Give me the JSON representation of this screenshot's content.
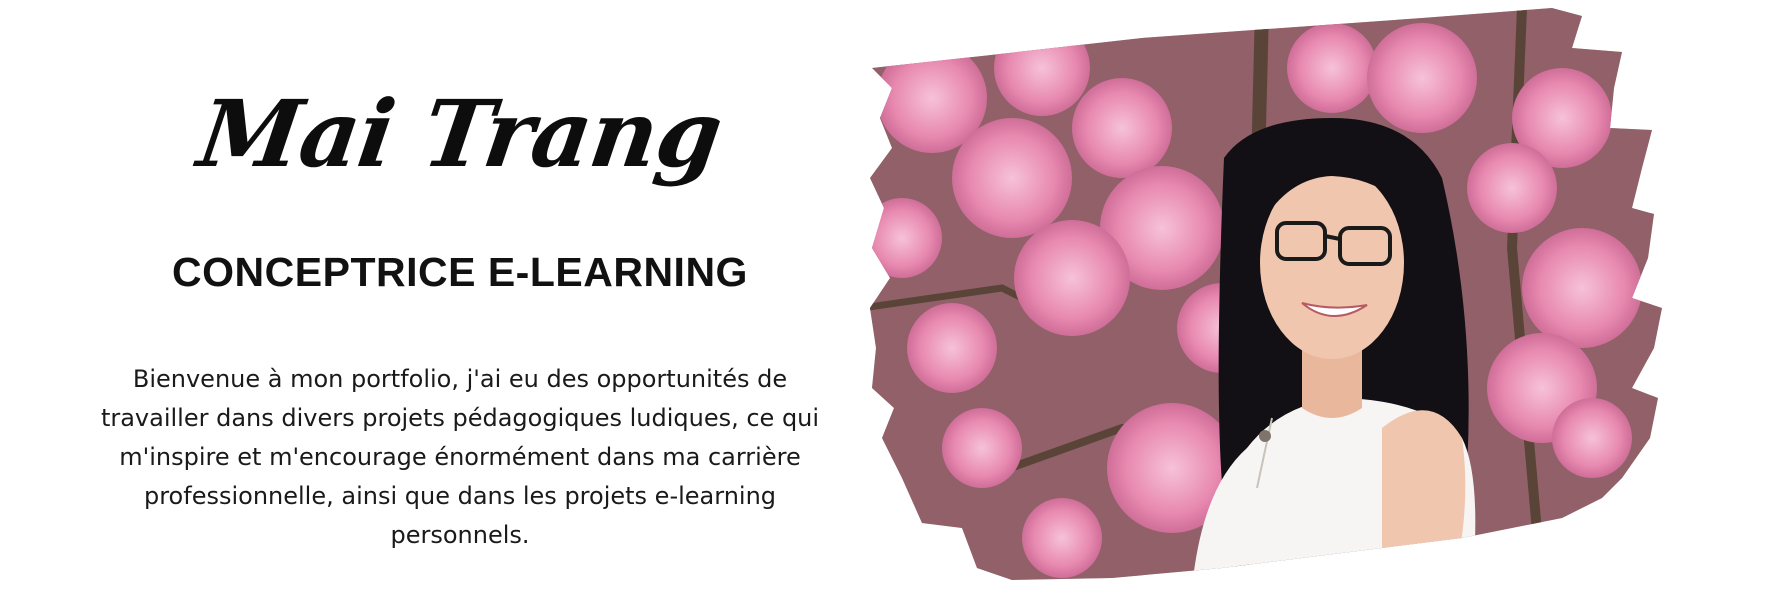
{
  "header": {
    "name": "Mai Trang",
    "role": "CONCEPTRICE E-LEARNING"
  },
  "intro": {
    "text": "Bienvenue à mon portfolio, j'ai eu des opportunités de travailler dans divers projets pédagogiques ludiques, ce qui m'inspire et m'encourage énormément dans ma carrière professionnelle, ainsi que dans les projets e-learning personnels."
  },
  "photo": {
    "subject": "portrait-among-cherry-blossoms",
    "colors": {
      "blossom": "#e889b0",
      "blossom_light": "#f3b6cf",
      "branch": "#5a4438",
      "hair": "#121014",
      "skin": "#f0c7ae",
      "shirt": "#f7f5f4"
    }
  }
}
